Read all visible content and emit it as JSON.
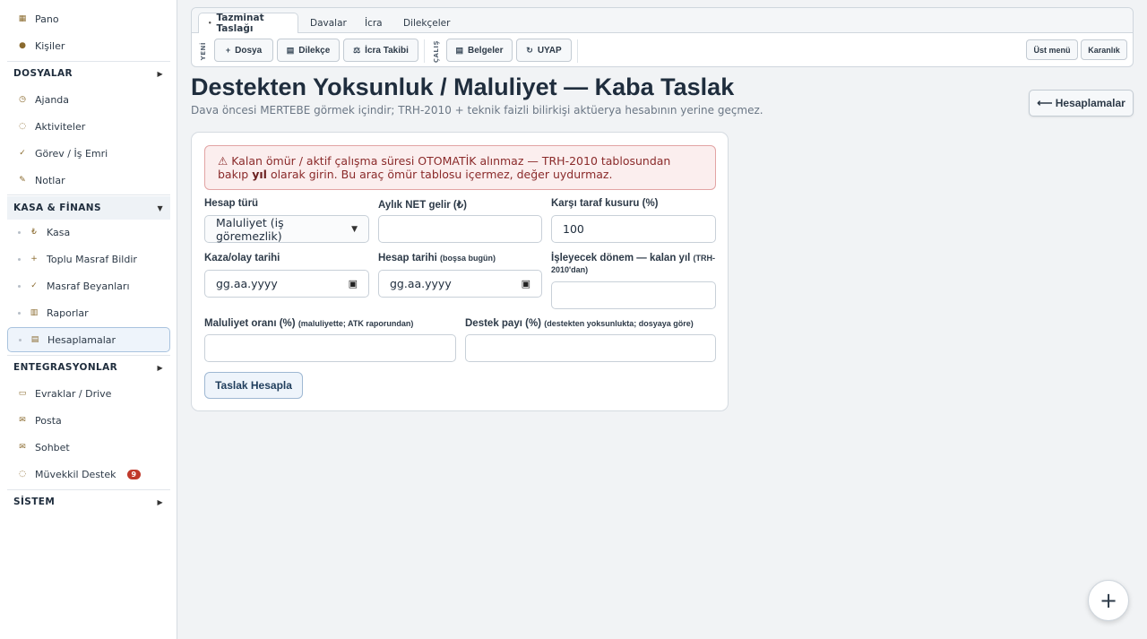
{
  "sidebar": {
    "top_items": [
      {
        "label": "Pano",
        "icon": "▦"
      },
      {
        "label": "Kişiler",
        "icon": "●"
      }
    ],
    "dosyalar": {
      "label": "DOSYALAR",
      "caret": "▶"
    },
    "dosyalar_items": [
      {
        "label": "Ajanda",
        "icon": "◷"
      },
      {
        "label": "Aktiviteler",
        "icon": "◌"
      },
      {
        "label": "Görev / İş Emri",
        "icon": "✓"
      },
      {
        "label": "Notlar",
        "icon": "✎"
      }
    ],
    "kasa": {
      "label": "KASA & FİNANS",
      "caret": "▼"
    },
    "kasa_items": [
      {
        "label": "Kasa",
        "icon": "₺"
      },
      {
        "label": "Toplu Masraf Bildir",
        "icon": "+"
      },
      {
        "label": "Masraf Beyanları",
        "icon": "✓"
      },
      {
        "label": "Raporlar",
        "icon": "▥"
      },
      {
        "label": "Hesaplamalar",
        "icon": "▤"
      }
    ],
    "entegrasyonlar": {
      "label": "ENTEGRASYONLAR",
      "caret": "▶"
    },
    "entegrasyon_items": [
      {
        "label": "Evraklar / Drive",
        "icon": "▭"
      },
      {
        "label": "Posta",
        "icon": "✉"
      },
      {
        "label": "Sohbet",
        "icon": "✉"
      },
      {
        "label": "Müvekkil Destek",
        "icon": "◌",
        "badge": "9"
      }
    ],
    "sistem": {
      "label": "SİSTEM",
      "caret": "▶"
    }
  },
  "topbar": {
    "tabs": [
      {
        "label": "Tazminat Taslağı",
        "prefix": "•"
      },
      {
        "label": "Davalar"
      },
      {
        "label": "İcra"
      },
      {
        "label": "Dilekçeler"
      }
    ],
    "label_yeni": "YENİ",
    "label_calis": "ÇALIŞ",
    "buttons": [
      {
        "label": "Dosya",
        "icon": "+"
      },
      {
        "label": "Dilekçe",
        "icon": "▤"
      },
      {
        "label": "İcra Takibi",
        "icon": "⚖"
      },
      {
        "label": "Belgeler",
        "icon": "▤"
      },
      {
        "label": "UYAP",
        "icon": "↻"
      }
    ],
    "ust_menu": "Üst menü",
    "karanlik": "Karanlık"
  },
  "page": {
    "title": "Destekten Yoksunluk / Maluliyet — Kaba Taslak",
    "subtitle": "Dava öncesi MERTEBE görmek içindir; TRH-2010 + teknik faizli bilirkişi aktüerya hesabının yerine geçmez.",
    "back_button": "⟵ Hesaplamalar"
  },
  "form": {
    "alert_icon": "⚠",
    "alert_part1": "Kalan ömür / aktif çalışma süresi OTOMATİK alınmaz — TRH-2010 tablosundan bakıp",
    "alert_bold": "yıl",
    "alert_part2": "olarak girin. Bu araç ömür tablosu içermez, değer uydurmaz.",
    "hesap_turu_label": "Hesap türü",
    "hesap_turu_value": "Maluliyet (iş göremezlik)",
    "aylik_gelir_label": "Aylık NET gelir (₺)",
    "aylik_gelir_value": "",
    "kusur_label": "Karşı taraf kusuru (%)",
    "kusur_value": "100",
    "kaza_tarihi_label": "Kaza/olay tarihi",
    "kaza_tarihi_value": "gg.aa.yyyy",
    "hesap_tarihi_label": "Hesap tarihi",
    "hesap_tarihi_hint": "(boşsa bugün)",
    "hesap_tarihi_value": "gg.aa.yyyy",
    "donem_label": "İşleyecek dönem — kalan yıl",
    "donem_hint_1": "(TRH-",
    "donem_hint_2": "2010'dan)",
    "donem_value": "",
    "maluliyet_label": "Maluliyet oranı (%)",
    "maluliyet_hint": "(maluliyette; ATK raporundan)",
    "maluliyet_value": "",
    "destek_label": "Destek payı (%)",
    "destek_hint": "(destekten yoksunlukta; dosyaya göre)",
    "destek_value": "",
    "calc_button": "Taslak Hesapla"
  },
  "fab": "+"
}
